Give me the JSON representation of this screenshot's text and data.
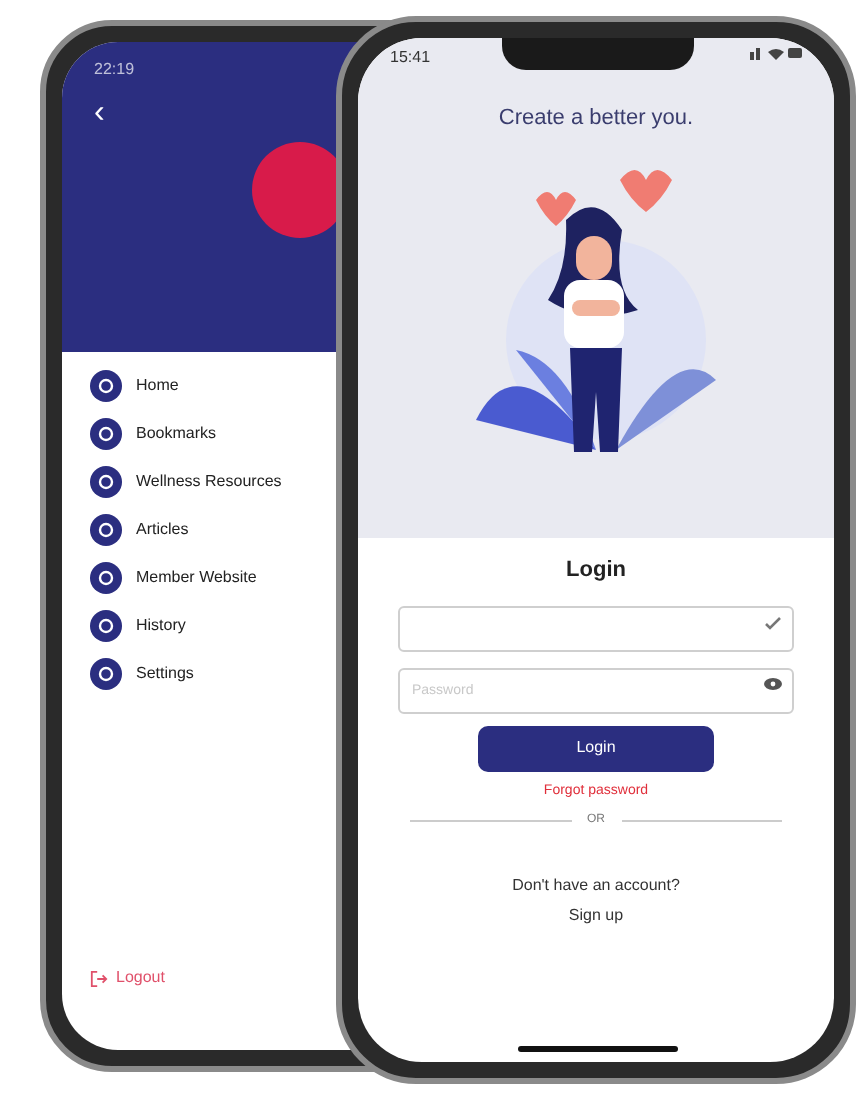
{
  "menu_phone": {
    "status_time": "22:19",
    "back_glyph": "‹",
    "items": [
      {
        "label": "Home"
      },
      {
        "label": "Bookmarks"
      },
      {
        "label": "Wellness Resources"
      },
      {
        "label": "Articles"
      },
      {
        "label": "Member Website"
      },
      {
        "label": "History"
      },
      {
        "label": "Settings"
      }
    ],
    "logout": "Logout"
  },
  "login_phone": {
    "status_time": "15:41",
    "headline": "Create a better you.",
    "heading": "Login",
    "fields": [
      {
        "kind": "username"
      },
      {
        "kind": "password",
        "placeholder": "Password"
      }
    ],
    "button": "Login",
    "forgot": "Forgot password",
    "divider": "OR",
    "prompt": "Don't have an account?",
    "signup": "Sign up"
  }
}
